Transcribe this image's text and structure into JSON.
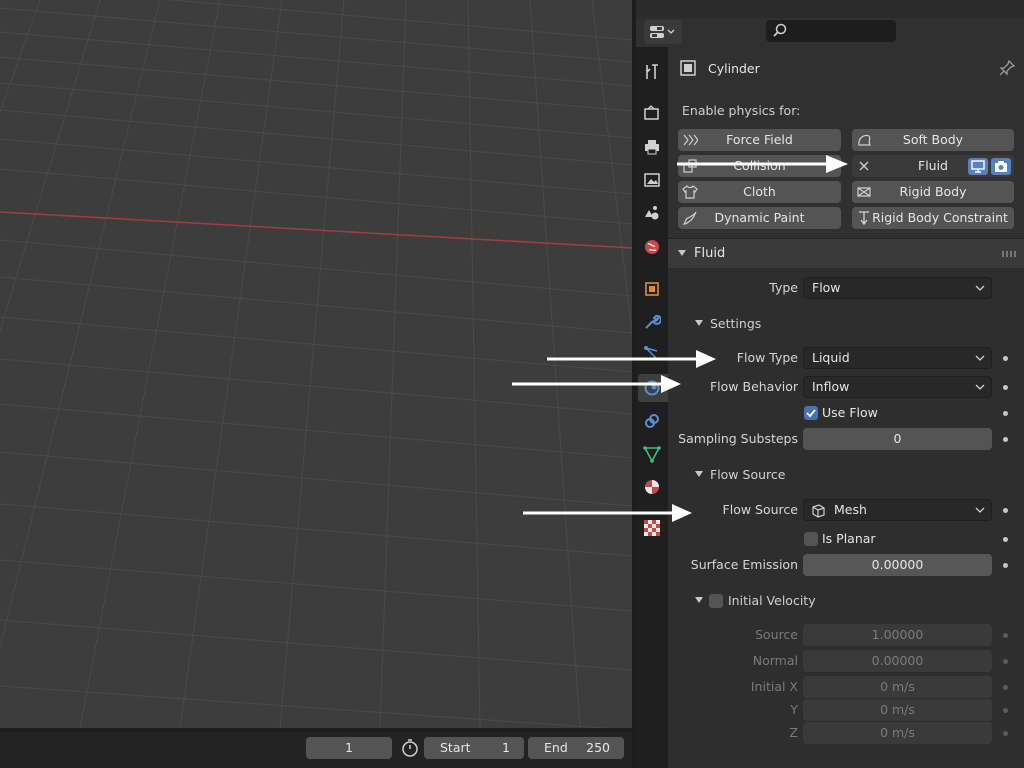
{
  "object": {
    "name": "Cylinder"
  },
  "physics": {
    "enable_label": "Enable physics for:",
    "buttons": {
      "force_field": "Force Field",
      "soft_body": "Soft Body",
      "collision": "Collision",
      "fluid": "Fluid",
      "cloth": "Cloth",
      "rigid_body": "Rigid Body",
      "dynamic_paint": "Dynamic Paint",
      "rigid_body_constraint": "Rigid Body Constraint"
    }
  },
  "fluid_panel": {
    "title": "Fluid",
    "type_label": "Type",
    "type_value": "Flow"
  },
  "settings_panel": {
    "title": "Settings",
    "flow_type_label": "Flow Type",
    "flow_type_value": "Liquid",
    "flow_behavior_label": "Flow Behavior",
    "flow_behavior_value": "Inflow",
    "use_flow_label": "Use Flow",
    "use_flow_checked": true,
    "sampling_substeps_label": "Sampling Substeps",
    "sampling_substeps_value": "0"
  },
  "flow_source_panel": {
    "title": "Flow Source",
    "flow_source_label": "Flow Source",
    "flow_source_value": "Mesh",
    "is_planar_label": "Is Planar",
    "surface_emission_label": "Surface Emission",
    "surface_emission_value": "0.00000"
  },
  "initial_velocity_panel": {
    "title": "Initial Velocity",
    "source_label": "Source",
    "source_value": "1.00000",
    "normal_label": "Normal",
    "normal_value": "0.00000",
    "initial_x_label": "Initial X",
    "initial_x_value": "0 m/s",
    "y_label": "Y",
    "y_value": "0 m/s",
    "z_label": "Z",
    "z_value": "0 m/s"
  },
  "timeline": {
    "current_frame": "1",
    "start_label": "Start",
    "start_value": "1",
    "end_label": "End",
    "end_value": "250"
  },
  "colors": {
    "accent": "#4772b3",
    "viewport_bg": "#3d3d3d",
    "x_axis": "#a83a42"
  }
}
